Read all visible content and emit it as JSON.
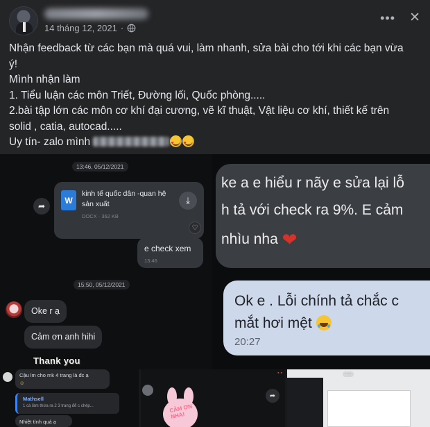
{
  "post": {
    "date": "14 tháng 12, 2021",
    "more_icon": "more-horizontal-icon",
    "close_icon": "close-icon",
    "lines": [
      "Nhận feedback từ các bạn mà quá vui, làm nhanh, sửa bài cho tới khi các bạn vừa",
      "ý!",
      "Mình nhận làm",
      "1. Tiểu luận các môn Triết, Đường lối, Quốc phòng.....",
      "2.bài tập lớn các môn cơ khí đại cương, vẽ kĩ thuật, Vật liệu cơ khí,  thiết kế trên",
      "solid , catia, autocad....."
    ],
    "last_line_prefix": "Uy tín- zalo mình"
  },
  "chat_left": {
    "time1": "13:46, 05/12/2021",
    "file_name": "kinh tế quốc dân -quan hệ sản xuất",
    "file_meta": "DOCX · 362 KB",
    "out_message": "e check xem",
    "out_time": "13:46",
    "time2": "15:50, 05/12/2021",
    "in_messages": [
      "Oke r ạ",
      "Cảm ơn anh hihi"
    ],
    "sticker_text": "Thank you"
  },
  "chat_right": {
    "big_lines": [
      "ke a e hiểu r nãy e sửa lại lỗ",
      "h tả với check ra 9%. E cảm",
      "nhìu nha"
    ],
    "blue_lines": [
      "Ok e . Lỗi chính tả chắc c",
      "mắt hơi mệt"
    ],
    "blue_time": "20:27"
  },
  "thumb1": {
    "msg1": "Cậu lm cho mk 4 trang là đc ạ",
    "quote_author": "Mathsell",
    "quote_text": "1 cá làm thừa ra 2 3 trang để c chép...",
    "reply": "Nhiệt tình quá ạ"
  },
  "thumb2": {
    "sticker_caption": "CẢM ƠN NHA!"
  },
  "colors": {
    "accent_blue": "#3b82f6",
    "heart_red": "#d2332b",
    "bubble_blue": "#cdd8ea"
  }
}
